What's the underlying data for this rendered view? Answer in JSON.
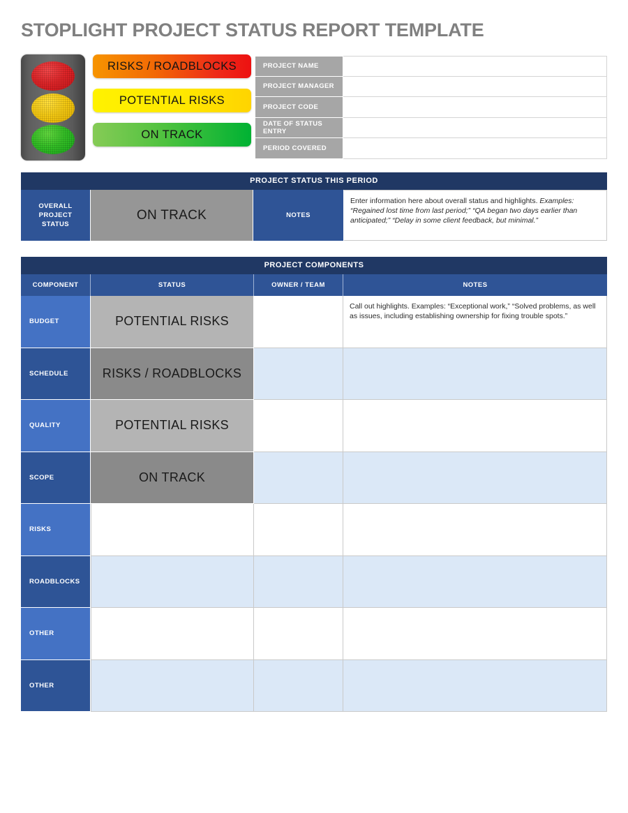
{
  "document": {
    "title": "STOPLIGHT PROJECT STATUS REPORT TEMPLATE"
  },
  "legend": {
    "bars": [
      {
        "label": "RISKS / ROADBLOCKS",
        "color_from": "#F79400",
        "color_to": "#ED1111",
        "lamp": "red"
      },
      {
        "label": "POTENTIAL RISKS",
        "color_from": "#FFF200",
        "color_to": "#FFD400",
        "lamp": "yellow"
      },
      {
        "label": "ON TRACK",
        "color_from": "#86CB56",
        "color_to": "#00B233",
        "lamp": "green"
      }
    ],
    "stoplight": {
      "icon": "traffic-light-icon",
      "housing_color": "#5E5E5E",
      "lamps": [
        {
          "name": "red-lamp",
          "color": "#E02629"
        },
        {
          "name": "yellow-lamp",
          "color": "#F6CB14"
        },
        {
          "name": "green-lamp",
          "color": "#34BF26"
        }
      ]
    }
  },
  "project_info": {
    "fields": [
      {
        "label": "PROJECT NAME",
        "value": ""
      },
      {
        "label": "PROJECT MANAGER",
        "value": ""
      },
      {
        "label": "PROJECT CODE",
        "value": ""
      },
      {
        "label": "DATE OF STATUS ENTRY",
        "value": ""
      },
      {
        "label": "PERIOD COVERED",
        "value": ""
      }
    ]
  },
  "status_period": {
    "section_title": "PROJECT STATUS THIS PERIOD",
    "overall_label": "OVERALL PROJECT STATUS",
    "overall_label_lines": [
      "OVERALL",
      "PROJECT",
      "STATUS"
    ],
    "overall_status": "ON TRACK",
    "notes_label": "NOTES",
    "notes_intro": "Enter information here about overall status and highlights.",
    "notes_examples": "Examples: “Regained lost time from last period;” “QA began two days earlier than anticipated;” “Delay in some client feedback, but minimal.”"
  },
  "components": {
    "section_title": "PROJECT COMPONENTS",
    "columns": [
      "COMPONENT",
      "STATUS",
      "OWNER / TEAM",
      "NOTES"
    ],
    "rows": [
      {
        "component": "BUDGET",
        "status": "POTENTIAL RISKS",
        "owner": "",
        "notes": "Call out highlights. Examples: “Exceptional work,” “Solved problems, as well as issues, including establishing ownership for fixing trouble spots.”"
      },
      {
        "component": "SCHEDULE",
        "status": "RISKS / ROADBLOCKS",
        "owner": "",
        "notes": ""
      },
      {
        "component": "QUALITY",
        "status": "POTENTIAL RISKS",
        "owner": "",
        "notes": ""
      },
      {
        "component": "SCOPE",
        "status": "ON TRACK",
        "owner": "",
        "notes": ""
      },
      {
        "component": "RISKS",
        "status": "",
        "owner": "",
        "notes": ""
      },
      {
        "component": "ROADBLOCKS",
        "status": "",
        "owner": "",
        "notes": ""
      },
      {
        "component": "OTHER",
        "status": "",
        "owner": "",
        "notes": ""
      },
      {
        "component": "OTHER",
        "status": "",
        "owner": "",
        "notes": ""
      }
    ]
  },
  "colors": {
    "title_gray": "#808080",
    "section_header_navy": "#203864",
    "column_header_blue": "#2F5496",
    "row_label_light_blue": "#4472C4",
    "row_label_dark_blue": "#2E5496",
    "status_gray_light": "#B4B4B4",
    "status_gray_dark": "#8A8A8A",
    "overall_status_gray": "#969696",
    "alt_row_blue": "#DBE8F7",
    "info_label_gray": "#A6A6A6"
  }
}
